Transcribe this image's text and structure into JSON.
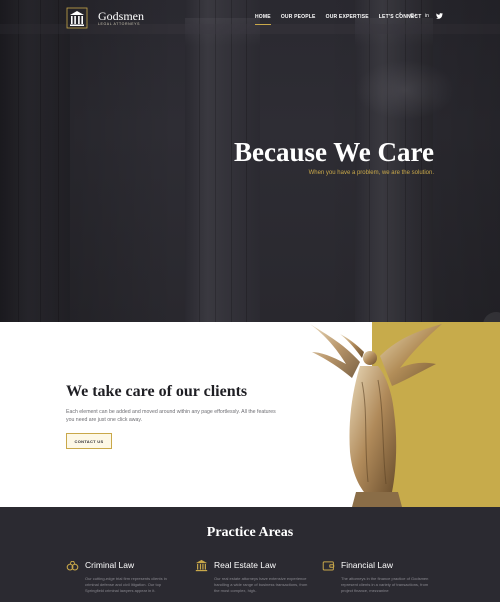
{
  "nav": {
    "logo": {
      "name": "Godsmen",
      "subtitle": "LEGAL ATTORNEYS"
    },
    "menu": [
      {
        "label": "HOME",
        "active": true
      },
      {
        "label": "OUR PEOPLE",
        "active": false
      },
      {
        "label": "OUR EXPERTISE",
        "active": false
      },
      {
        "label": "LET'S CONNECT",
        "active": false
      }
    ],
    "social": [
      "f",
      "G+",
      "in",
      "t"
    ]
  },
  "hero": {
    "title": "Because We Care",
    "subtitle": "When you have a problem, we are the solution."
  },
  "care": {
    "title": "We take care of our clients",
    "text": "Each element can be added and moved around within any page effortlessly. All the features you need are just one click away.",
    "button": "CONTACT US"
  },
  "practice": {
    "title": "Practice Areas",
    "areas": [
      {
        "name": "Criminal Law",
        "icon": "handcuffs-icon",
        "desc": "Our cutting-edge trial firm represents clients in criminal defense and civil litigation. Our top Springfield criminal lawyers appear in it."
      },
      {
        "name": "Real Estate Law",
        "icon": "bank-icon",
        "desc": "Our real estate attorneys have extensive experience handling a wide range of business transactions, from the most complex, high-"
      },
      {
        "name": "Financial Law",
        "icon": "wallet-icon",
        "desc": "The attorneys in the finance practice of Godsmen represent clients in a variety of transactions, from project finance, mezzanine"
      }
    ]
  },
  "colors": {
    "accent": "#c9a84a",
    "dark": "#2b2a31",
    "gold_block": "#c7ab4b"
  }
}
